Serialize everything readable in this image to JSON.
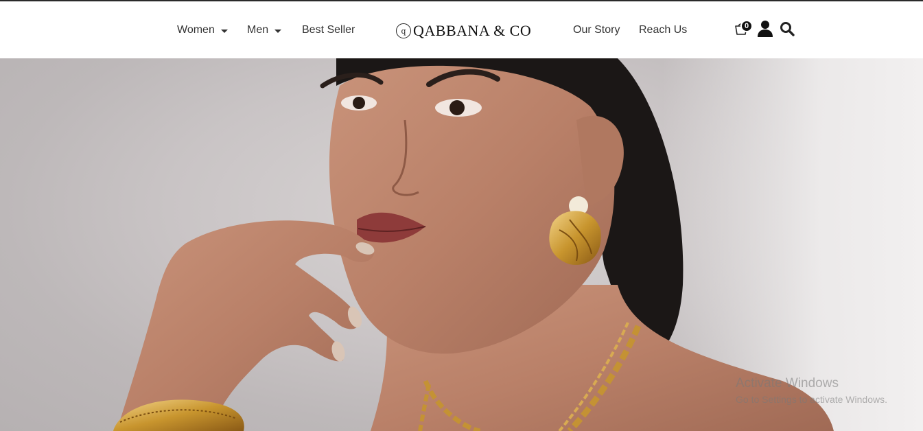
{
  "nav": {
    "women": "Women",
    "men": "Men",
    "best_seller": "Best Seller",
    "our_story": "Our Story",
    "reach_us": "Reach Us"
  },
  "brand": {
    "logo_text": "QABBANA & CO",
    "logo_mark": "q"
  },
  "header_icons": {
    "cart_count": "0",
    "cart": "cart-icon",
    "user": "user-icon",
    "search": "search-icon"
  },
  "hero": {
    "image": "model wearing gold shell earrings, gold chain necklace and mesh bangle"
  },
  "os_watermark": {
    "title": "Activate Windows",
    "subtitle": "Go to Settings to activate Windows."
  },
  "colors": {
    "text": "#333333",
    "accent": "#111111",
    "background": "#ffffff"
  }
}
